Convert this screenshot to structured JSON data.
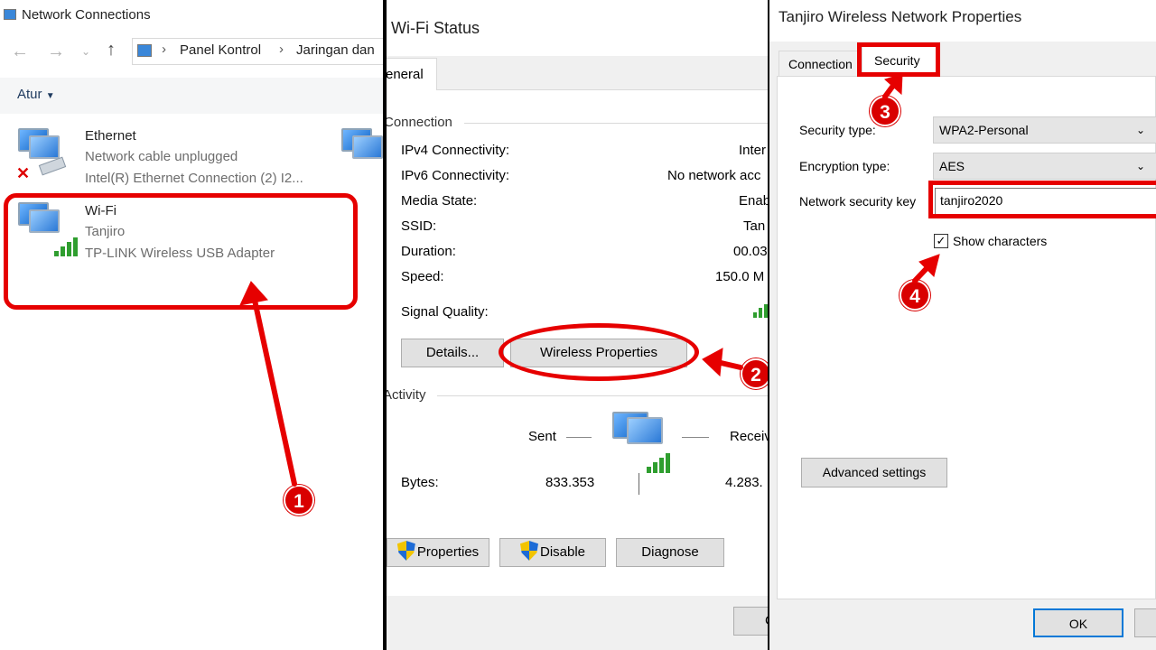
{
  "explorer": {
    "window_title": "Network Connections",
    "breadcrumb": [
      "Panel Kontrol",
      "Jaringan dan"
    ],
    "organize_label": "Atur",
    "adapters": [
      {
        "name": "Ethernet",
        "status": "Network cable unplugged",
        "device": "Intel(R) Ethernet Connection (2) I2...",
        "icon": "ethernet-disconnected-icon"
      },
      {
        "name": "Wi-Fi",
        "status": "Tanjiro",
        "device": "TP-LINK Wireless USB Adapter",
        "icon": "wifi-adapter-icon"
      }
    ]
  },
  "wifi_status": {
    "window_title": "Wi-Fi Status",
    "tab_general": "eneral",
    "connection_group": "Connection",
    "rows": [
      {
        "label": "IPv4 Connectivity:",
        "value": "Inter"
      },
      {
        "label": "IPv6 Connectivity:",
        "value": "No network acc"
      },
      {
        "label": "Media State:",
        "value": "Enab"
      },
      {
        "label": "SSID:",
        "value": "Tan"
      },
      {
        "label": "Duration:",
        "value": "00.03"
      },
      {
        "label": "Speed:",
        "value": "150.0 M"
      }
    ],
    "signal_quality_label": "Signal Quality:",
    "details_button": "Details...",
    "wireless_properties_button": "Wireless Properties",
    "activity_group": "Activity",
    "sent_label": "Sent",
    "received_label": "Receiv",
    "bytes_label": "Bytes:",
    "bytes_sent": "833.353",
    "bytes_received": "4.283.",
    "properties_button": "Properties",
    "disable_button": "Disable",
    "diagnose_button": "Diagnose",
    "close_button": "C"
  },
  "properties": {
    "window_title": "Tanjiro Wireless Network Properties",
    "tabs": [
      "Connection",
      "Security"
    ],
    "security_type_label": "Security type:",
    "security_type_value": "WPA2-Personal",
    "encryption_type_label": "Encryption type:",
    "encryption_type_value": "AES",
    "network_key_label": "Network security key",
    "network_key_value": "tanjiro2020",
    "show_characters_label": "Show characters",
    "show_characters_checked": "✓",
    "advanced_button": "Advanced settings",
    "ok_button": "OK"
  },
  "annotations": {
    "steps": [
      "1",
      "2",
      "3",
      "4"
    ],
    "highlight_color": "#e60000"
  }
}
